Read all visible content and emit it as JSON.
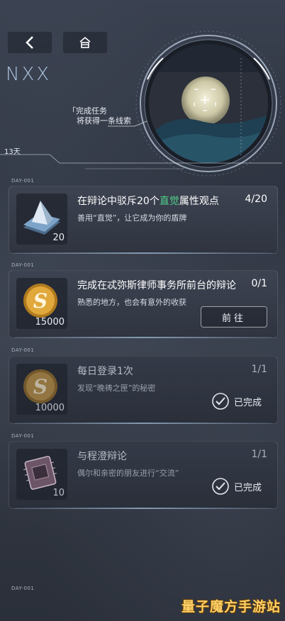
{
  "brand": {
    "logo_text": "NXX"
  },
  "nav": {
    "back_icon": "chevron-left-icon",
    "home_icon": "home-icon"
  },
  "tip": {
    "line1": "「完成任务",
    "line2": "将获得一条线索"
  },
  "day": {
    "label": "13天"
  },
  "quests": [
    {
      "section": "DAY-001",
      "title_pre": "在辩论中驳斥20个",
      "title_highlight": "直觉",
      "title_post": "属性观点",
      "progress": "4/20",
      "desc": "善用“直觉”，让它成为你的盾牌",
      "reward_icon": "pyramid-card-icon",
      "reward_qty": "20",
      "status": "in_progress"
    },
    {
      "section": "DAY-001",
      "title": "完成在忒弥斯律师事务所前台的辩论",
      "progress": "0/1",
      "desc": "熟悉的地方，也会有意外的收获",
      "reward_icon": "s-coin-icon",
      "reward_qty": "15000",
      "action_label": "前往",
      "status": "available"
    },
    {
      "section": "DAY-001",
      "title": "每日登录1次",
      "progress": "1/1",
      "desc": "发现“晚祷之匣”的秘密",
      "reward_icon": "s-coin-icon",
      "reward_qty": "10000",
      "done_label": "已完成",
      "status": "completed"
    },
    {
      "section": "DAY-001",
      "title": "与程澄辩论",
      "progress": "1/1",
      "desc": "偶尔和亲密的朋友进行“交流”",
      "reward_icon": "chip-card-icon",
      "reward_qty": "10",
      "done_label": "已完成",
      "status": "completed"
    }
  ],
  "footer": {
    "section": "DAY-001"
  },
  "watermark": "量子魔方手游站",
  "colors": {
    "highlight": "#4fd08a",
    "accent_blue": "#a9c3de"
  }
}
